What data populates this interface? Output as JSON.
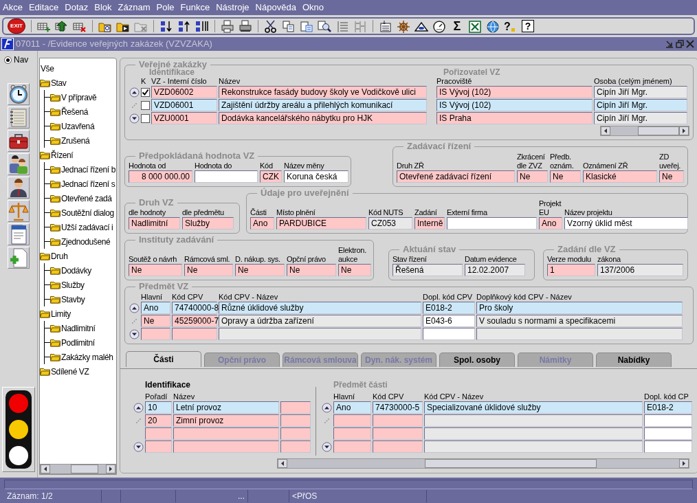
{
  "menu": [
    "Akce",
    "Editace",
    "Dotaz",
    "Blok",
    "Záznam",
    "Pole",
    "Funkce",
    "Nástroje",
    "Nápověda",
    "Okno"
  ],
  "toolbar": {
    "exit_label": "EXIT",
    "sum_glyph": "Σ",
    "help_glyphs": [
      "?",
      "?"
    ]
  },
  "window": {
    "title": "07011 - /Evidence veřejných zakázek (VZVZAKA)"
  },
  "nav": {
    "label": "Nav",
    "selected": true
  },
  "tree": [
    {
      "label": "Vše",
      "kind": "root"
    },
    {
      "label": "Stav",
      "kind": "folder",
      "children": [
        {
          "label": "V přípravě"
        },
        {
          "label": "Řešená"
        },
        {
          "label": "Uzavřená"
        },
        {
          "label": "Zrušená"
        }
      ]
    },
    {
      "label": "Řízení",
      "kind": "folder",
      "children": [
        {
          "label": "Jednací řízení b"
        },
        {
          "label": "Jednací řízení s"
        },
        {
          "label": "Otevřené zadá"
        },
        {
          "label": "Soutěžní dialog"
        },
        {
          "label": "Užší zadávací i"
        },
        {
          "label": "Zjednodušené"
        }
      ]
    },
    {
      "label": "Druh",
      "kind": "folder",
      "children": [
        {
          "label": "Dodávky"
        },
        {
          "label": "Služby"
        },
        {
          "label": "Stavby"
        }
      ]
    },
    {
      "label": "Limity",
      "kind": "folder",
      "children": [
        {
          "label": "Nadlimitní"
        },
        {
          "label": "Podlimitní"
        },
        {
          "label": "Zakázky maléh"
        }
      ]
    },
    {
      "label": "Sdílené VZ",
      "kind": "folder"
    }
  ],
  "contracts": {
    "title": "Veřejné zakázky",
    "groups": [
      {
        "label": "Identifikace",
        "active": false
      },
      {
        "label": "Pořizovatel VZ",
        "active": false
      }
    ],
    "check_column": {
      "label": "K"
    },
    "columns": [
      {
        "label": "VZ - Interní číslo",
        "kind": "required"
      },
      {
        "label": "Název",
        "kind": "required"
      },
      {
        "label": "Pracoviště",
        "kind": "required"
      },
      {
        "label": "Osoba (celým jménem)",
        "kind": "readonly"
      }
    ],
    "rows": [
      {
        "selected": false,
        "checked": true,
        "cells": [
          "VZD06002",
          "Rekonstrukce fasády budovy školy ve Vodičkově ulici",
          "IS Vývoj (102)",
          "Cipín Jiří Mgr."
        ]
      },
      {
        "selected": true,
        "checked": false,
        "cells": [
          "VZD06001",
          "Zajištění údržby areálu a přilehlých komunikací",
          "IS Vývoj (102)",
          "Cipín Jiří Mgr."
        ]
      },
      {
        "selected": false,
        "checked": false,
        "cells": [
          "VZU0001",
          "Dodávka kancelářského nábytku pro HJK",
          "IS Praha",
          "Cipín Jiří Mgr."
        ]
      }
    ]
  },
  "forms": [
    {
      "title": "Předpokládaná hodnota VZ",
      "fields": [
        {
          "label": "Hodnota od",
          "value": "8 000 000.00",
          "kind": "required",
          "numeric": true
        },
        {
          "label": "Hodnota do",
          "kind": "editable"
        },
        {
          "label": "Kód",
          "value": "CZK",
          "kind": "required"
        },
        {
          "label": "Název měny",
          "value": "Koruna česká",
          "kind": "editable"
        }
      ]
    },
    {
      "title": "Zadávací řízení",
      "fields": [
        {
          "label": "Druh ZŘ",
          "value": "Otevřené zadávací řízení",
          "kind": "required"
        },
        {
          "label": "Zkrácení dle ZVZ",
          "value": "Ne",
          "kind": "required"
        },
        {
          "label": "Předb. oznám.",
          "value": "Ne",
          "kind": "required"
        },
        {
          "label": "Oznámení ZŘ",
          "value": "Klasické",
          "kind": "required"
        },
        {
          "label": "ZD uveřej.",
          "value": "Ne",
          "kind": "required"
        }
      ]
    },
    {
      "title": "Druh VZ",
      "fields": [
        {
          "label": "dle hodnoty",
          "value": "Nadlimitní",
          "kind": "required"
        },
        {
          "label": "dle předmětu",
          "value": "Služby",
          "kind": "required"
        }
      ]
    },
    {
      "title": "Údaje pro uveřejnění",
      "fields": [
        {
          "label": "Části",
          "value": "Ano",
          "kind": "required"
        },
        {
          "label": "Místo plnění",
          "value": "PARDUBICE",
          "kind": "required"
        },
        {
          "label": "Kód NUTS",
          "value": "CZ053",
          "kind": "readonly"
        },
        {
          "label": "Zadání",
          "value": "Interně",
          "kind": "required"
        },
        {
          "label": "Externí firma",
          "kind": "editable"
        },
        {
          "label": "Projekt EU",
          "value": "Ano",
          "kind": "required"
        },
        {
          "label": "Název projektu",
          "value": "Vzorný úklid měst",
          "kind": "editable"
        }
      ]
    },
    {
      "title": "Instituty zadávání",
      "fields": [
        {
          "label": "Soutěž o návrh",
          "value": "Ne",
          "kind": "required"
        },
        {
          "label": "Rámcová sml.",
          "value": "Ne",
          "kind": "required"
        },
        {
          "label": "D. nákup. sys.",
          "value": "Ne",
          "kind": "required"
        },
        {
          "label": "Opční právo",
          "value": "Ne",
          "kind": "required"
        },
        {
          "label": "Elektron. aukce",
          "value": "Ne",
          "kind": "required"
        }
      ]
    },
    {
      "title": "Aktuání stav",
      "fields": [
        {
          "label": "Stav řízení",
          "value": "Řešená",
          "kind": "readonly"
        },
        {
          "label": "Datum evidence",
          "value": "12.02.2007",
          "kind": "readonly"
        }
      ]
    },
    {
      "title": "Zadání dle VZ",
      "fields": [
        {
          "label": "Verze modulu",
          "value": "1",
          "kind": "required"
        },
        {
          "label": "zákona",
          "value": "137/2006",
          "kind": "readonly"
        }
      ]
    }
  ],
  "subjects": {
    "title": "Předmět VZ",
    "columns": [
      {
        "label": "Hlavní",
        "kind": "required"
      },
      {
        "label": "Kód CPV",
        "kind": "required"
      },
      {
        "label": "Kód CPV - Název",
        "kind": "readonly"
      },
      {
        "label": "Dopl. kód CPV",
        "kind": "editable"
      },
      {
        "label": "Doplňkový kód CPV - Název",
        "kind": "readonly"
      }
    ],
    "rows": [
      {
        "selected": true,
        "cells": [
          "Ano",
          "74740000-8",
          "Různé úklidové služby",
          "E018-2",
          "Pro školy"
        ]
      },
      {
        "selected": false,
        "cells": [
          "Ne",
          "45259000-7",
          "Opravy a údržba zařízení",
          "E043-6",
          "V souladu s normami a specifikacemi"
        ]
      },
      {
        "selected": false
      }
    ]
  },
  "tabs": [
    {
      "label": "Části",
      "selected": true,
      "disabled": false
    },
    {
      "label": "Opční právo",
      "selected": false,
      "disabled": true
    },
    {
      "label": "Rámcová smlouva",
      "selected": false,
      "disabled": true
    },
    {
      "label": "Dyn. nák. systém",
      "selected": false,
      "disabled": true
    },
    {
      "label": "Spol. osoby",
      "selected": false,
      "disabled": false
    },
    {
      "label": "Námitky",
      "selected": false,
      "disabled": true
    },
    {
      "label": "Nabídky",
      "selected": false,
      "disabled": false
    }
  ],
  "parts": {
    "title": "Identifikace",
    "active": true,
    "columns": [
      {
        "label": "Pořadí",
        "kind": "required"
      },
      {
        "label": "Název",
        "kind": "required"
      },
      {
        "kind": "marker"
      }
    ],
    "rows": [
      {
        "selected": true,
        "cells": [
          "10",
          "Letní provoz"
        ]
      },
      {
        "selected": false,
        "cells": [
          "20",
          "Zimní provoz"
        ]
      },
      {
        "selected": false
      },
      {
        "selected": false
      }
    ]
  },
  "part_subjects": {
    "title": "Předmět části",
    "active": false,
    "columns": [
      {
        "label": "Hlavní",
        "kind": "required"
      },
      {
        "label": "Kód CPV",
        "kind": "required"
      },
      {
        "label": "Kód CPV - Název",
        "kind": "readonly"
      },
      {
        "label": "Dopl. kód CP",
        "kind": "editable"
      }
    ],
    "rows": [
      {
        "selected": true,
        "cells": [
          "Ano",
          "74730000-5",
          "Specializované úklidové služby",
          "E018-2"
        ]
      },
      {
        "selected": false
      },
      {
        "selected": false
      },
      {
        "selected": false
      }
    ]
  },
  "status_bar": {
    "fields": [
      "Záznam: 1/2",
      "...",
      "<PřOS"
    ]
  }
}
